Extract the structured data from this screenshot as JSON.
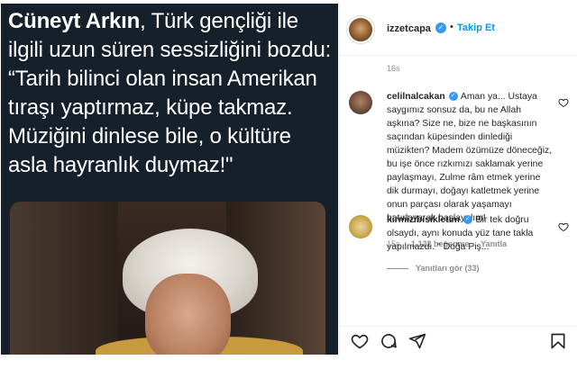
{
  "post": {
    "tweet": {
      "author": "Cüneyt Arkın",
      "text": ", Türk gençliği ile ilgili uzun süren sessizliğini bozdu: “Tarih bilinci olan insan Amerikan tıraşı yaptırmaz, küpe takmaz. Müziğini dinlese bile, o kültüre asla hayranlık duymaz!\""
    }
  },
  "header": {
    "username": "izzetcapa",
    "verified_glyph": "✓",
    "separator": "•",
    "follow_label": "Takip Et"
  },
  "caption_time": "16s",
  "comments": [
    {
      "username": "celilnalcakan",
      "verified_glyph": "✓",
      "text": "Aman ya... Ustaya saygımız sonsuz da, bu ne Allah aşkına? Size ne, bize ne başkasının saçından küpesinden dinlediği müzikten? Madem özümüze döneceğiz, bu işe önce rızkımızı saklamak yerine paylaşmayı, Zulme râm etmek yerine dik durmayı, doğayı katletmek yerine onun parçası olarak yaşamayı hatırlayarak başlayalım!",
      "time": "15s",
      "likes": "1.122 beğenme",
      "reply_label": "Yanıtla",
      "view_replies": "Yanıtları gör (33)"
    },
    {
      "username": "kirmizibisikletim",
      "verified_glyph": "✓",
      "text": "Bir tek doğru olsaydı, aynı konuda yüz tane takla yapılmazdı. \" Doğa Piş..."
    }
  ],
  "icons": {
    "heart": "heart-icon",
    "comment": "comment-icon",
    "share": "paper-plane-icon",
    "save": "bookmark-icon"
  },
  "colors": {
    "tweet_bg": "#15202b",
    "link_blue": "#0095f6",
    "verified_blue": "#3897f0"
  }
}
